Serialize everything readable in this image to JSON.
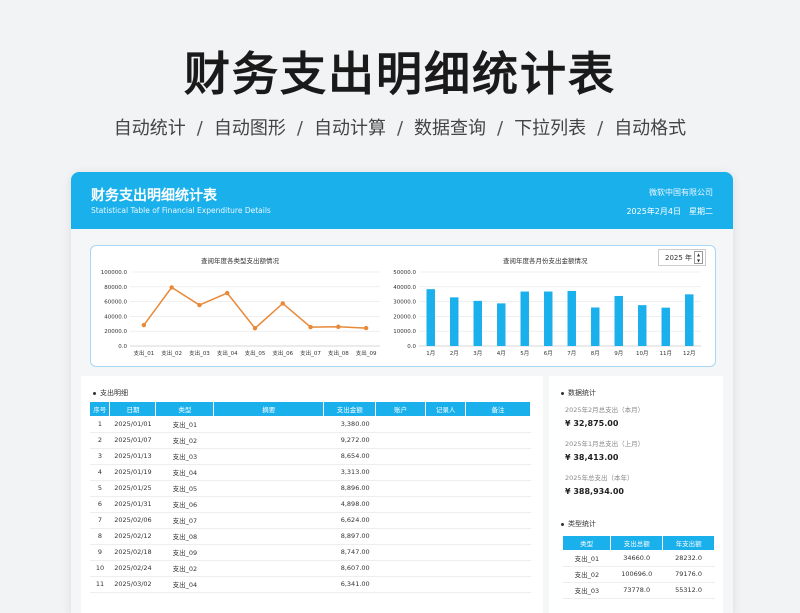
{
  "hero": {
    "title": "财务支出明细统计表",
    "features": [
      "自动统计",
      "自动图形",
      "自动计算",
      "数据查询",
      "下拉列表",
      "自动格式"
    ]
  },
  "header": {
    "title": "财务支出明细统计表",
    "subtitle": "Statistical Table of Financial Expenditure Details",
    "company": "微软中国有限公司",
    "date": "2025年2月4日",
    "weekday": "星期二"
  },
  "controls": {
    "year": "2025 年",
    "spin_up": "▲",
    "spin_down": "▼"
  },
  "chart_data": [
    {
      "type": "line",
      "title": "查阅年度各类型支出额情况",
      "categories": [
        "支出_01",
        "支出_02",
        "支出_03",
        "支出_04",
        "支出_05",
        "支出_06",
        "支出_07",
        "支出_08",
        "支出_09"
      ],
      "values": [
        28232.0,
        79176.0,
        55312.0,
        71500.0,
        24000.0,
        57500.0,
        25500.0,
        26000.0,
        24200.0
      ],
      "yticks": [
        "100000.0",
        "80000.0",
        "60000.0",
        "40000.0",
        "20000.0",
        "0.0"
      ],
      "ylim": [
        0,
        100000
      ],
      "color": "#e8893a"
    },
    {
      "type": "bar",
      "title": "查阅年度各月份支出金额情况",
      "categories": [
        "1月",
        "2月",
        "3月",
        "4月",
        "5月",
        "6月",
        "7月",
        "8月",
        "9月",
        "10月",
        "11月",
        "12月"
      ],
      "values": [
        38413,
        32875,
        30500,
        28800,
        36800,
        36800,
        37200,
        26000,
        33800,
        27600,
        25900,
        34900
      ],
      "yticks": [
        "50000.0",
        "40000.0",
        "30000.0",
        "20000.0",
        "10000.0",
        "0.0"
      ],
      "ylim": [
        0,
        50000
      ],
      "color": "#1ab0ec"
    }
  ],
  "details": {
    "title": "支出明细",
    "columns": [
      "序号",
      "日期",
      "类型",
      "摘要",
      "支出金额",
      "账户",
      "记录人",
      "备注"
    ],
    "rows": [
      [
        "1",
        "2025/01/01",
        "支出_01",
        "",
        "3,380.00",
        "",
        "",
        ""
      ],
      [
        "2",
        "2025/01/07",
        "支出_02",
        "",
        "9,272.00",
        "",
        "",
        ""
      ],
      [
        "3",
        "2025/01/13",
        "支出_03",
        "",
        "8,654.00",
        "",
        "",
        ""
      ],
      [
        "4",
        "2025/01/19",
        "支出_04",
        "",
        "3,313.00",
        "",
        "",
        ""
      ],
      [
        "5",
        "2025/01/25",
        "支出_05",
        "",
        "8,896.00",
        "",
        "",
        ""
      ],
      [
        "6",
        "2025/01/31",
        "支出_06",
        "",
        "4,898.00",
        "",
        "",
        ""
      ],
      [
        "7",
        "2025/02/06",
        "支出_07",
        "",
        "6,624.00",
        "",
        "",
        ""
      ],
      [
        "8",
        "2025/02/12",
        "支出_08",
        "",
        "8,897.00",
        "",
        "",
        ""
      ],
      [
        "9",
        "2025/02/18",
        "支出_09",
        "",
        "8,747.00",
        "",
        "",
        ""
      ],
      [
        "10",
        "2025/02/24",
        "支出_02",
        "",
        "8,607.00",
        "",
        "",
        ""
      ],
      [
        "11",
        "2025/03/02",
        "支出_04",
        "",
        "6,341.00",
        "",
        "",
        ""
      ]
    ]
  },
  "stats": {
    "title": "数据统计",
    "items": [
      {
        "label": "2025年2月总支出（本月）",
        "value": "¥ 32,875.00"
      },
      {
        "label": "2025年1月总支出（上月）",
        "value": "¥ 38,413.00"
      },
      {
        "label": "2025年总支出（本年）",
        "value": "¥ 388,934.00"
      }
    ]
  },
  "types": {
    "title": "类型统计",
    "columns": [
      "类型",
      "支出总额",
      "年支出额"
    ],
    "rows": [
      [
        "支出_01",
        "34660.0",
        "28232.0"
      ],
      [
        "支出_02",
        "100696.0",
        "79176.0"
      ],
      [
        "支出_03",
        "73778.0",
        "55312.0"
      ]
    ]
  }
}
